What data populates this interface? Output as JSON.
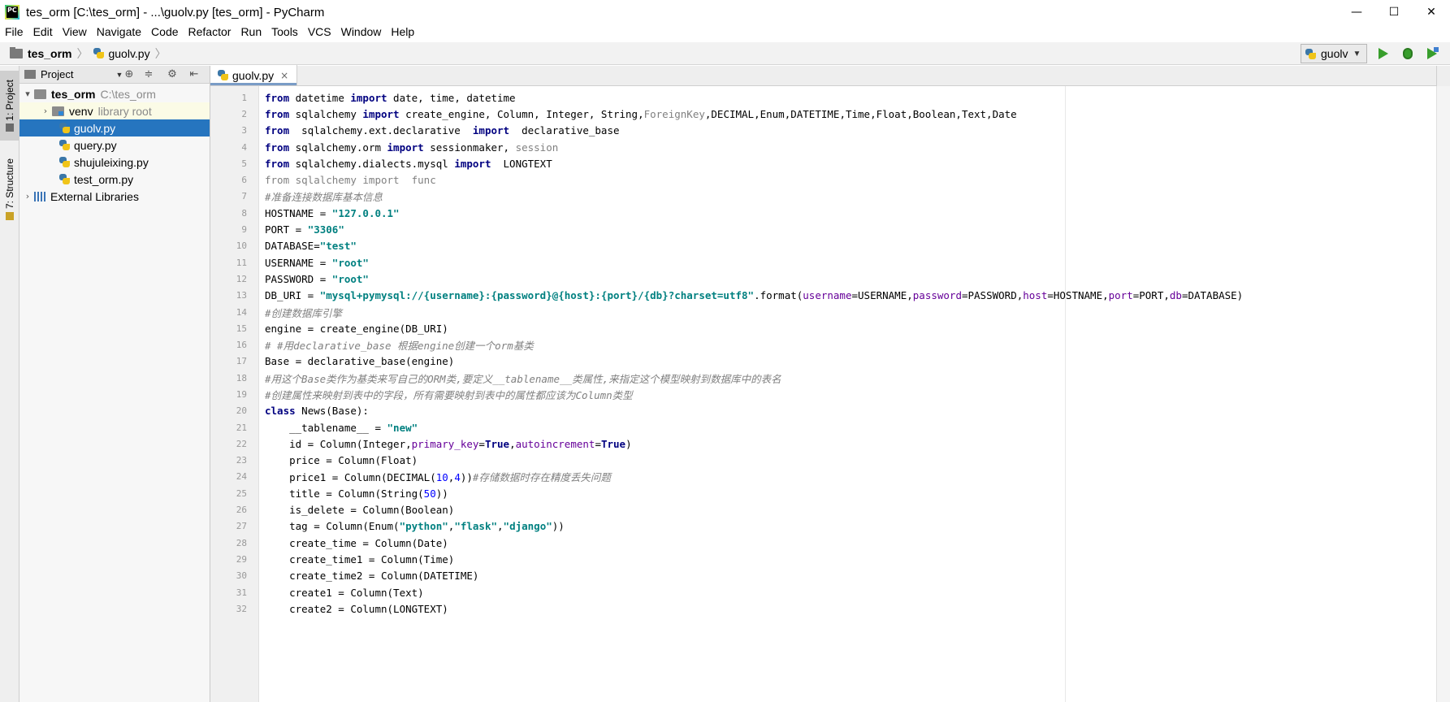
{
  "window": {
    "title": "tes_orm [C:\\tes_orm] - ...\\guolv.py [tes_orm] - PyCharm",
    "icon_label": "PC",
    "controls": [
      "—",
      "☐",
      "✕"
    ]
  },
  "menu": [
    "File",
    "Edit",
    "View",
    "Navigate",
    "Code",
    "Refactor",
    "Run",
    "Tools",
    "VCS",
    "Window",
    "Help"
  ],
  "breadcrumb": {
    "project": "tes_orm",
    "file": "guolv.py"
  },
  "run_config": {
    "name": "guolv"
  },
  "tool_stripe": {
    "project_tab": "1: Project",
    "structure_tab": "7: Structure"
  },
  "project_panel": {
    "title": "Project",
    "root": {
      "name": "tes_orm",
      "path": "C:\\tes_orm"
    },
    "venv": {
      "name": "venv",
      "note": "library root"
    },
    "files": [
      "guolv.py",
      "query.py",
      "shujuleixing.py",
      "test_orm.py"
    ],
    "selected_file": "guolv.py",
    "external_libraries": "External Libraries"
  },
  "editor": {
    "tab_label": "guolv.py",
    "code_lines": [
      [
        {
          "t": "from",
          "c": "kw"
        },
        {
          "t": " datetime "
        },
        {
          "t": "import",
          "c": "kw"
        },
        {
          "t": " date, time, datetime"
        }
      ],
      [
        {
          "t": "from",
          "c": "kw"
        },
        {
          "t": " sqlalchemy "
        },
        {
          "t": "import",
          "c": "kw"
        },
        {
          "t": " create_engine, Column, Integer, String,"
        },
        {
          "t": "ForeignKey",
          "c": "gr"
        },
        {
          "t": ",DECIMAL,Enum,DATETIME,Time,Float,Boolean,Text,Date"
        }
      ],
      [
        {
          "t": "from",
          "c": "kw"
        },
        {
          "t": "  sqlalchemy.ext.declarative  "
        },
        {
          "t": "import",
          "c": "kw"
        },
        {
          "t": "  declarative_base"
        }
      ],
      [
        {
          "t": "from",
          "c": "kw"
        },
        {
          "t": " sqlalchemy.orm "
        },
        {
          "t": "import",
          "c": "kw"
        },
        {
          "t": " sessionmaker, "
        },
        {
          "t": "session",
          "c": "gr"
        }
      ],
      [
        {
          "t": "from",
          "c": "kw"
        },
        {
          "t": " sqlalchemy.dialects.mysql "
        },
        {
          "t": "import",
          "c": "kw"
        },
        {
          "t": "  LONGTEXT"
        }
      ],
      [
        {
          "t": "from sqlalchemy import  func",
          "c": "gr"
        }
      ],
      [
        {
          "t": "#准备连接数据库基本信息",
          "c": "cm"
        }
      ],
      [
        {
          "t": "HOSTNAME = "
        },
        {
          "t": "\"127.0.0.1\"",
          "c": "str"
        }
      ],
      [
        {
          "t": "PORT = "
        },
        {
          "t": "\"3306\"",
          "c": "str"
        }
      ],
      [
        {
          "t": "DATABASE="
        },
        {
          "t": "\"test\"",
          "c": "str"
        }
      ],
      [
        {
          "t": "USERNAME = "
        },
        {
          "t": "\"root\"",
          "c": "str"
        }
      ],
      [
        {
          "t": "PASSWORD = "
        },
        {
          "t": "\"root\"",
          "c": "str"
        }
      ],
      [
        {
          "t": "DB_URI = "
        },
        {
          "t": "\"mysql+pymysql://{username}:{password}@{host}:{port}/{db}?charset=utf8\"",
          "c": "str"
        },
        {
          "t": ".format("
        },
        {
          "t": "username",
          "c": "kwarg"
        },
        {
          "t": "=USERNAME,"
        },
        {
          "t": "password",
          "c": "kwarg"
        },
        {
          "t": "=PASSWORD,"
        },
        {
          "t": "host",
          "c": "kwarg"
        },
        {
          "t": "=HOSTNAME,"
        },
        {
          "t": "port",
          "c": "kwarg"
        },
        {
          "t": "=PORT,"
        },
        {
          "t": "db",
          "c": "kwarg"
        },
        {
          "t": "=DATABASE)"
        }
      ],
      [
        {
          "t": "#创建数据库引擎",
          "c": "cm"
        }
      ],
      [
        {
          "t": "engine = create_engine(DB_URI)"
        }
      ],
      [
        {
          "t": "# #用declarative_base 根据engine创建一个orm基类",
          "c": "cm"
        }
      ],
      [
        {
          "t": "Base = declarative_base(engine)"
        }
      ],
      [
        {
          "t": "#用这个Base类作为基类来写自己的ORM类,要定义__tablename__类属性,来指定这个模型映射到数据库中的表名",
          "c": "cm"
        }
      ],
      [
        {
          "t": "#创建属性来映射到表中的字段，所有需要映射到表中的属性都应该为Column类型",
          "c": "cm"
        }
      ],
      [
        {
          "t": "class",
          "c": "kw"
        },
        {
          "t": " News(Base):"
        }
      ],
      [
        {
          "t": "    __tablename__ = "
        },
        {
          "t": "\"new\"",
          "c": "str"
        }
      ],
      [
        {
          "t": "    id = Column(Integer,"
        },
        {
          "t": "primary_key",
          "c": "kwarg"
        },
        {
          "t": "="
        },
        {
          "t": "True",
          "c": "kw"
        },
        {
          "t": ","
        },
        {
          "t": "autoincrement",
          "c": "kwarg"
        },
        {
          "t": "="
        },
        {
          "t": "True",
          "c": "kw"
        },
        {
          "t": ")"
        }
      ],
      [
        {
          "t": "    price = Column(Float)"
        }
      ],
      [
        {
          "t": "    price1 = Column(DECIMAL("
        },
        {
          "t": "10",
          "c": "num"
        },
        {
          "t": ","
        },
        {
          "t": "4",
          "c": "num"
        },
        {
          "t": "))"
        },
        {
          "t": "#存储数据时存在精度丢失问题",
          "c": "cm"
        }
      ],
      [
        {
          "t": "    title = Column(String("
        },
        {
          "t": "50",
          "c": "num"
        },
        {
          "t": "))"
        }
      ],
      [
        {
          "t": "    is_delete = Column(Boolean)"
        }
      ],
      [
        {
          "t": "    tag = Column(Enum("
        },
        {
          "t": "\"python\"",
          "c": "str"
        },
        {
          "t": ","
        },
        {
          "t": "\"flask\"",
          "c": "str"
        },
        {
          "t": ","
        },
        {
          "t": "\"django\"",
          "c": "str"
        },
        {
          "t": "))"
        }
      ],
      [
        {
          "t": "    create_time = Column(Date)"
        }
      ],
      [
        {
          "t": "    create_time1 = Column(Time)"
        }
      ],
      [
        {
          "t": "    create_time2 = Column(DATETIME)"
        }
      ],
      [
        {
          "t": "    create1 = Column(Text)"
        }
      ],
      [
        {
          "t": "    create2 = Column(LONGTEXT)"
        }
      ]
    ]
  }
}
